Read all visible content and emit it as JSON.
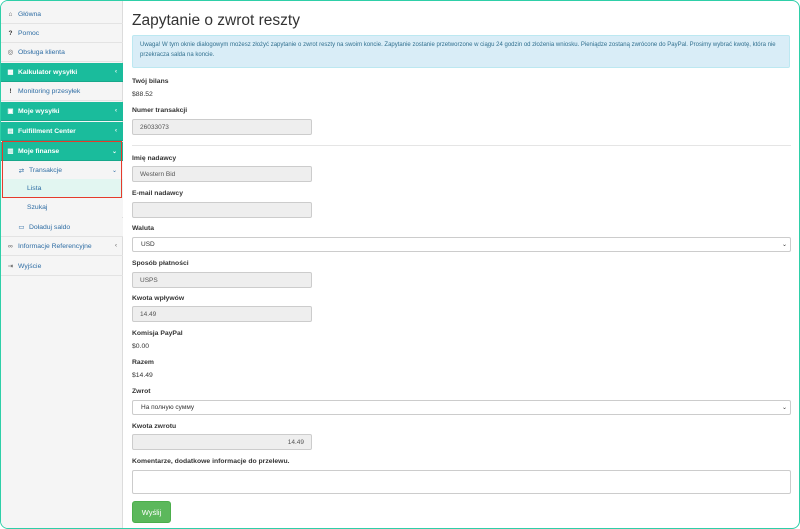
{
  "sidebar": {
    "items": [
      {
        "icon": "home-icon",
        "glyph": "⌂",
        "label": "Główna"
      },
      {
        "icon": "question-icon",
        "glyph": "?",
        "label": "Pomoc"
      },
      {
        "icon": "lifebuoy-icon",
        "glyph": "◎",
        "label": "Obsługa klienta"
      },
      {
        "icon": "calculator-icon",
        "glyph": "▦",
        "label": "Kalkulator wysyłki",
        "chevron": "‹"
      },
      {
        "icon": "exclamation-icon",
        "glyph": "!",
        "label": "Monitoring przesyłek"
      },
      {
        "icon": "box-icon",
        "glyph": "▣",
        "label": "Moje wysyłki",
        "chevron": "‹"
      },
      {
        "icon": "building-icon",
        "glyph": "▤",
        "label": "Fulfillment Center",
        "chevron": "‹"
      },
      {
        "icon": "wallet-icon",
        "glyph": "▥",
        "label": "Moje finanse",
        "chevron": "⌄"
      },
      {
        "icon": "exchange-icon",
        "glyph": "⇄",
        "label": "Transakcje",
        "chevron": "⌄"
      },
      {
        "label": "Lista"
      },
      {
        "label": "Szukaj"
      },
      {
        "icon": "money-icon",
        "glyph": "▭",
        "label": "Doładuj saldo"
      },
      {
        "icon": "link-icon",
        "glyph": "∞",
        "label": "Informacje Referencyjne",
        "chevron": "‹"
      },
      {
        "icon": "signout-icon",
        "glyph": "⇥",
        "label": "Wyjście"
      }
    ]
  },
  "page": {
    "title": "Zapytanie o zwrot reszty",
    "alert": "Uwaga! W tym oknie dialogowym możesz złożyć zapytanie o zwrot reszty na swoim koncie. Zapytanie zostanie przetworzone w ciągu 24 godzin od złożenia wniosku. Pieniądze zostaną zwrócone do PayPal. Prosimy wybrać kwotę, która nie przekracza salda na koncie."
  },
  "form": {
    "balance_label": "Twój bilans",
    "balance_value": "$88.52",
    "transaction_label": "Numer transakcji",
    "transaction_value": "26033073",
    "sender_name_label": "Imię nadawcy",
    "sender_name_value": "Western Bid",
    "sender_email_label": "E-mail nadawcy",
    "sender_email_value": "",
    "currency_label": "Waluta",
    "currency_value": "USD",
    "payment_method_label": "Sposób płatności",
    "payment_method_value": "USPS",
    "income_label": "Kwota wpływów",
    "income_value": "14.49",
    "paypal_fee_label": "Komisja PayPal",
    "paypal_fee_value": "$0.00",
    "total_label": "Razem",
    "total_value": "$14.49",
    "refund_label": "Zwrot",
    "refund_value": "На полную сумму",
    "refund_amount_label": "Kwota zwrotu",
    "refund_amount_value": "14.49",
    "comments_label": "Komentarze, dodatkowe informacje do przelewu.",
    "submit_label": "Wyślij"
  },
  "colors": {
    "accent": "#1abc9c",
    "highlight": "#e53b2c",
    "submit": "#5cb85c"
  }
}
